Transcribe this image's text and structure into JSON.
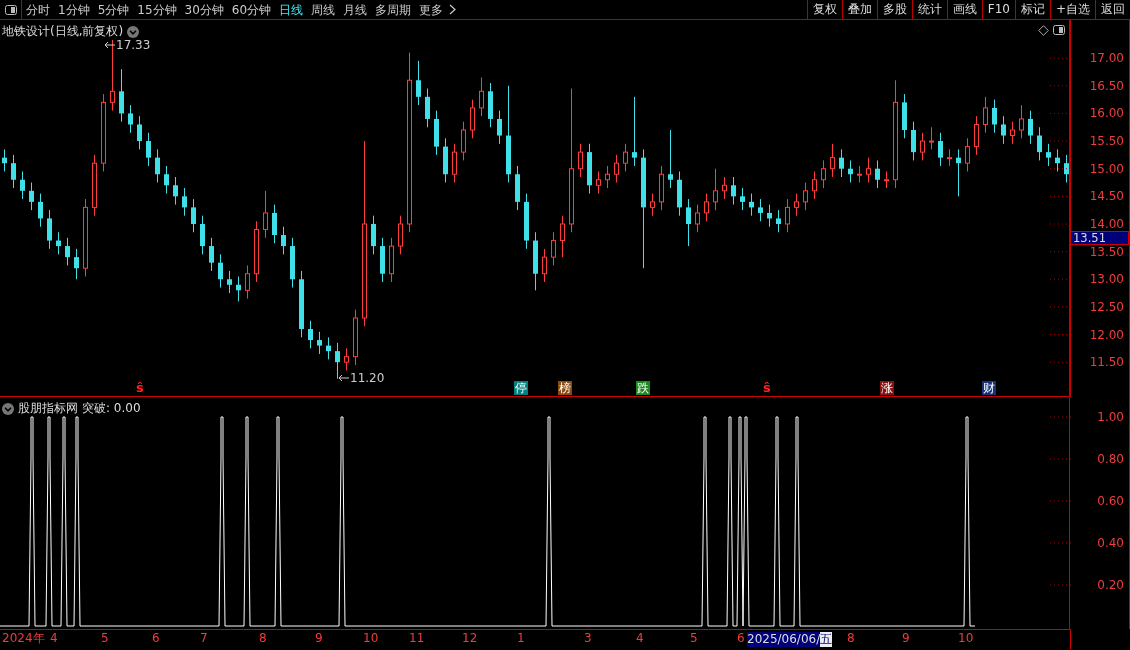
{
  "toolbar": {
    "periods": [
      {
        "label": "分时",
        "selected": false
      },
      {
        "label": "1分钟",
        "selected": false
      },
      {
        "label": "5分钟",
        "selected": false
      },
      {
        "label": "15分钟",
        "selected": false
      },
      {
        "label": "30分钟",
        "selected": false
      },
      {
        "label": "60分钟",
        "selected": false
      },
      {
        "label": "日线",
        "selected": true
      },
      {
        "label": "周线",
        "selected": false
      },
      {
        "label": "月线",
        "selected": false
      },
      {
        "label": "多周期",
        "selected": false
      }
    ],
    "more": "更多",
    "actions": [
      "复权",
      "叠加",
      "多股",
      "统计",
      "画线",
      "F10",
      "标记",
      "+自选",
      "返回"
    ]
  },
  "main_panel": {
    "title": "地铁设计(日线,前复权)",
    "chart_data": {
      "type": "candlestick",
      "ylim": [
        10.87,
        17.69
      ],
      "yticks": [
        {
          "value": 17,
          "label": "17.00"
        },
        {
          "value": 16.5,
          "label": "16.50"
        },
        {
          "value": 16,
          "label": "16.00"
        },
        {
          "value": 15.5,
          "label": "15.50"
        },
        {
          "value": 15,
          "label": "15.00"
        },
        {
          "value": 14.5,
          "label": "14.50"
        },
        {
          "value": 14,
          "label": "14.00"
        },
        {
          "value": 13.5,
          "label": "13.50"
        },
        {
          "value": 13,
          "label": "13.00"
        },
        {
          "value": 12.5,
          "label": "12.50"
        },
        {
          "value": 12,
          "label": "12.00"
        },
        {
          "value": 11.5,
          "label": "11.50"
        }
      ],
      "ohlc": [
        [
          15.2,
          15.35,
          14.95,
          15.1
        ],
        [
          15.1,
          15.25,
          14.65,
          14.8
        ],
        [
          14.8,
          14.95,
          14.45,
          14.6
        ],
        [
          14.6,
          14.75,
          14.25,
          14.4
        ],
        [
          14.4,
          14.55,
          13.95,
          14.1
        ],
        [
          14.1,
          14.25,
          13.55,
          13.7
        ],
        [
          13.7,
          13.85,
          13.45,
          13.6
        ],
        [
          13.6,
          13.75,
          13.25,
          13.4
        ],
        [
          13.4,
          13.55,
          13.0,
          13.2
        ],
        [
          13.2,
          14.45,
          13.05,
          14.3
        ],
        [
          14.3,
          15.25,
          14.15,
          15.1
        ],
        [
          15.1,
          16.35,
          14.95,
          16.2
        ],
        [
          16.2,
          17.33,
          16.05,
          16.4
        ],
        [
          16.4,
          16.8,
          15.85,
          16.0
        ],
        [
          16.0,
          16.15,
          15.65,
          15.8
        ],
        [
          15.8,
          15.95,
          15.35,
          15.5
        ],
        [
          15.5,
          15.65,
          15.05,
          15.2
        ],
        [
          15.2,
          15.35,
          14.75,
          14.9
        ],
        [
          14.9,
          15.05,
          14.55,
          14.7
        ],
        [
          14.7,
          14.85,
          14.35,
          14.5
        ],
        [
          14.5,
          14.65,
          14.15,
          14.3
        ],
        [
          14.3,
          14.45,
          13.85,
          14.0
        ],
        [
          14.0,
          14.15,
          13.45,
          13.6
        ],
        [
          13.6,
          13.75,
          13.15,
          13.3
        ],
        [
          13.3,
          13.45,
          12.85,
          13.0
        ],
        [
          13.0,
          13.15,
          12.75,
          12.9
        ],
        [
          12.9,
          13.05,
          12.6,
          12.8
        ],
        [
          12.8,
          13.25,
          12.65,
          13.1
        ],
        [
          13.1,
          14.05,
          12.95,
          13.9
        ],
        [
          13.9,
          14.6,
          13.75,
          14.2
        ],
        [
          14.2,
          14.35,
          13.65,
          13.8
        ],
        [
          13.8,
          13.95,
          13.45,
          13.6
        ],
        [
          13.6,
          13.75,
          12.85,
          13.0
        ],
        [
          13.0,
          13.15,
          11.95,
          12.1
        ],
        [
          12.1,
          12.25,
          11.75,
          11.9
        ],
        [
          11.9,
          12.05,
          11.65,
          11.8
        ],
        [
          11.8,
          11.95,
          11.55,
          11.7
        ],
        [
          11.7,
          11.85,
          11.2,
          11.5
        ],
        [
          11.5,
          11.75,
          11.35,
          11.6
        ],
        [
          11.6,
          12.45,
          11.45,
          12.3
        ],
        [
          12.3,
          15.5,
          12.15,
          14.0
        ],
        [
          14.0,
          14.15,
          13.45,
          13.6
        ],
        [
          13.6,
          13.75,
          12.95,
          13.1
        ],
        [
          13.1,
          13.75,
          12.95,
          13.6
        ],
        [
          13.6,
          14.15,
          13.45,
          14.0
        ],
        [
          14.0,
          17.1,
          13.85,
          16.6
        ],
        [
          16.6,
          16.95,
          16.15,
          16.3
        ],
        [
          16.3,
          16.45,
          15.75,
          15.9
        ],
        [
          15.9,
          16.05,
          15.25,
          15.4
        ],
        [
          15.4,
          15.55,
          14.75,
          14.9
        ],
        [
          14.9,
          15.45,
          14.75,
          15.3
        ],
        [
          15.3,
          15.85,
          15.15,
          15.7
        ],
        [
          15.7,
          16.25,
          15.55,
          16.1
        ],
        [
          16.1,
          16.65,
          15.95,
          16.4
        ],
        [
          16.4,
          16.55,
          15.75,
          15.9
        ],
        [
          15.9,
          16.05,
          15.45,
          15.6
        ],
        [
          15.6,
          16.5,
          14.75,
          14.9
        ],
        [
          14.9,
          15.05,
          14.25,
          14.4
        ],
        [
          14.4,
          14.55,
          13.55,
          13.7
        ],
        [
          13.7,
          13.85,
          12.8,
          13.1
        ],
        [
          13.1,
          13.55,
          12.95,
          13.4
        ],
        [
          13.4,
          13.85,
          13.25,
          13.7
        ],
        [
          13.7,
          14.15,
          13.4,
          14.0
        ],
        [
          14.0,
          16.45,
          13.85,
          15.0
        ],
        [
          15.0,
          15.45,
          14.85,
          15.3
        ],
        [
          15.3,
          15.45,
          14.55,
          14.7
        ],
        [
          14.7,
          14.95,
          14.55,
          14.8
        ],
        [
          14.8,
          15.05,
          14.65,
          14.9
        ],
        [
          14.9,
          15.25,
          14.75,
          15.1
        ],
        [
          15.1,
          15.45,
          14.95,
          15.3
        ],
        [
          15.3,
          16.3,
          15.05,
          15.2
        ],
        [
          15.2,
          15.35,
          13.2,
          14.3
        ],
        [
          14.3,
          14.55,
          14.15,
          14.4
        ],
        [
          14.4,
          15.05,
          14.25,
          14.9
        ],
        [
          14.9,
          15.7,
          14.65,
          14.8
        ],
        [
          14.8,
          14.95,
          14.15,
          14.3
        ],
        [
          14.3,
          14.45,
          13.6,
          14.0
        ],
        [
          14.0,
          14.35,
          13.85,
          14.2
        ],
        [
          14.2,
          14.55,
          14.05,
          14.4
        ],
        [
          14.4,
          15.0,
          14.25,
          14.6
        ],
        [
          14.6,
          14.85,
          14.45,
          14.7
        ],
        [
          14.7,
          14.85,
          14.35,
          14.5
        ],
        [
          14.5,
          14.65,
          14.25,
          14.4
        ],
        [
          14.4,
          14.55,
          14.15,
          14.3
        ],
        [
          14.3,
          14.45,
          14.05,
          14.2
        ],
        [
          14.2,
          14.35,
          13.95,
          14.1
        ],
        [
          14.1,
          14.25,
          13.85,
          14.0
        ],
        [
          14.0,
          14.45,
          13.85,
          14.3
        ],
        [
          14.3,
          14.55,
          14.15,
          14.4
        ],
        [
          14.4,
          14.75,
          14.25,
          14.6
        ],
        [
          14.6,
          14.95,
          14.45,
          14.8
        ],
        [
          14.8,
          15.15,
          14.65,
          15.0
        ],
        [
          15.0,
          15.45,
          14.85,
          15.2
        ],
        [
          15.2,
          15.35,
          14.85,
          15.0
        ],
        [
          15.0,
          15.15,
          14.75,
          14.9
        ],
        [
          14.9,
          15.05,
          14.75,
          14.9
        ],
        [
          14.9,
          15.2,
          14.75,
          15.0
        ],
        [
          15.0,
          15.15,
          14.65,
          14.8
        ],
        [
          14.8,
          14.95,
          14.65,
          14.8
        ],
        [
          14.8,
          16.6,
          14.65,
          16.2
        ],
        [
          16.2,
          16.35,
          15.55,
          15.7
        ],
        [
          15.7,
          15.85,
          15.15,
          15.3
        ],
        [
          15.3,
          15.65,
          15.15,
          15.5
        ],
        [
          15.5,
          15.75,
          15.35,
          15.5
        ],
        [
          15.5,
          15.65,
          15.05,
          15.2
        ],
        [
          15.2,
          15.35,
          15.05,
          15.2
        ],
        [
          15.2,
          15.35,
          14.5,
          15.1
        ],
        [
          15.1,
          15.55,
          14.95,
          15.4
        ],
        [
          15.4,
          15.95,
          15.25,
          15.8
        ],
        [
          15.8,
          16.3,
          15.65,
          16.1
        ],
        [
          16.1,
          16.25,
          15.65,
          15.8
        ],
        [
          15.8,
          15.95,
          15.45,
          15.6
        ],
        [
          15.6,
          15.85,
          15.45,
          15.7
        ],
        [
          15.7,
          16.15,
          15.55,
          15.9
        ],
        [
          15.9,
          16.05,
          15.45,
          15.6
        ],
        [
          15.6,
          15.75,
          15.15,
          15.3
        ],
        [
          15.3,
          15.45,
          15.05,
          15.2
        ],
        [
          15.2,
          15.35,
          14.95,
          15.1
        ],
        [
          15.1,
          15.25,
          14.75,
          14.9
        ]
      ]
    },
    "last_price": "13.51",
    "high_label": "17.33",
    "low_label": "11.20",
    "markers": [
      {
        "kind": "sign",
        "text": "ŝ",
        "color": "#ff2020"
      },
      {
        "kind": "tag",
        "text": "停",
        "color": "#00807f"
      },
      {
        "kind": "tag",
        "text": "榜",
        "color": "#8b4a10"
      },
      {
        "kind": "tag",
        "text": "跌",
        "color": "#1a8a1a"
      },
      {
        "kind": "sign",
        "text": "ŝ",
        "color": "#ff2020"
      },
      {
        "kind": "tag",
        "text": "涨",
        "color": "#8a1010"
      },
      {
        "kind": "tag",
        "text": "财",
        "color": "#16337a"
      }
    ]
  },
  "indicator_panel": {
    "name": "股朋指标网",
    "reading": "突破: 0.00",
    "axis": [
      "1.00",
      "0.80",
      "0.60",
      "0.40",
      "0.20"
    ]
  },
  "date_axis": {
    "labels": [
      "2024年",
      "4",
      "5",
      "6",
      "7",
      "8",
      "9",
      "10",
      "11",
      "12",
      "1",
      "3",
      "4",
      "5",
      "6",
      "8",
      "9",
      "10"
    ],
    "cursor_date": "2025/06/06/",
    "cursor_weekday": "五"
  }
}
